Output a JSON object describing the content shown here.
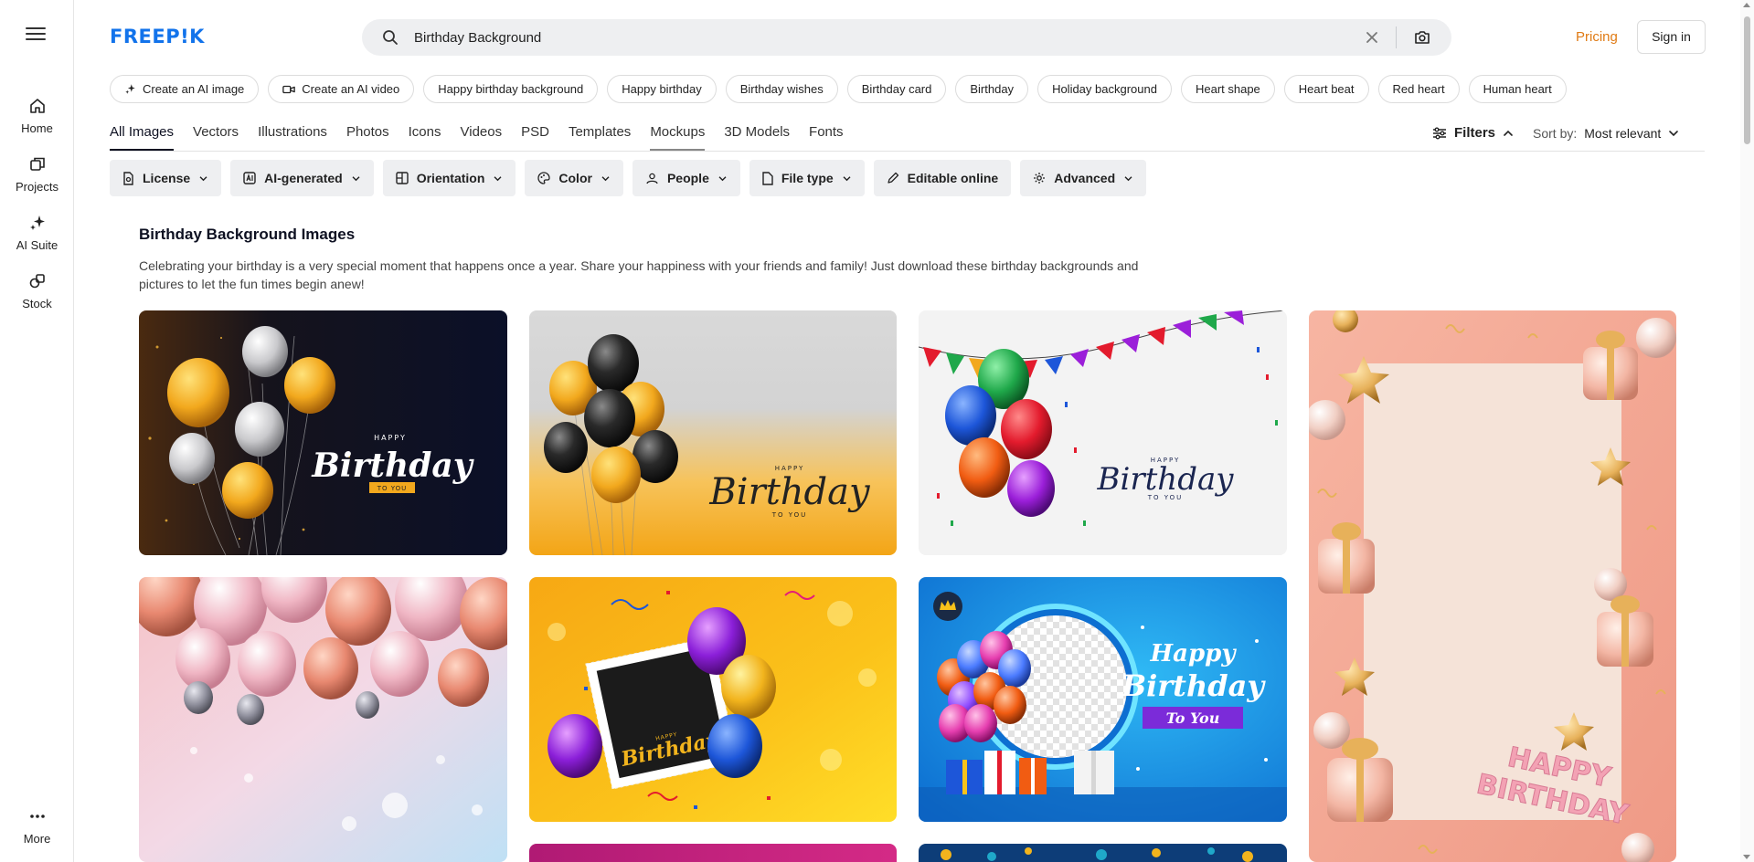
{
  "rail": {
    "items": [
      {
        "label": "Home",
        "icon": "home-icon"
      },
      {
        "label": "Projects",
        "icon": "projects-icon"
      },
      {
        "label": "AI Suite",
        "icon": "sparkle-icon"
      },
      {
        "label": "Stock",
        "icon": "stock-icon"
      }
    ],
    "more_label": "More"
  },
  "header": {
    "logo": "FREEP!K",
    "search_value": "Birthday Background",
    "pricing": "Pricing",
    "signin": "Sign in"
  },
  "chips": [
    {
      "label": "Create an AI image",
      "icon": "sparkle-icon"
    },
    {
      "label": "Create an AI video",
      "icon": "video-icon"
    },
    {
      "label": "Happy birthday background"
    },
    {
      "label": "Happy birthday"
    },
    {
      "label": "Birthday wishes"
    },
    {
      "label": "Birthday card"
    },
    {
      "label": "Birthday"
    },
    {
      "label": "Holiday background"
    },
    {
      "label": "Heart shape"
    },
    {
      "label": "Heart beat"
    },
    {
      "label": "Red heart"
    },
    {
      "label": "Human heart"
    }
  ],
  "tabs": {
    "items": [
      "All Images",
      "Vectors",
      "Illustrations",
      "Photos",
      "Icons",
      "Videos",
      "PSD",
      "Templates",
      "Mockups",
      "3D Models",
      "Fonts"
    ],
    "active": "All Images",
    "filters_label": "Filters",
    "sort_label": "Sort by:",
    "sort_value": "Most relevant"
  },
  "filter_buttons": [
    {
      "label": "License",
      "icon": "license-icon"
    },
    {
      "label": "AI-generated",
      "icon": "ai-icon"
    },
    {
      "label": "Orientation",
      "icon": "orientation-icon"
    },
    {
      "label": "Color",
      "icon": "palette-icon"
    },
    {
      "label": "People",
      "icon": "people-icon"
    },
    {
      "label": "File type",
      "icon": "file-icon"
    },
    {
      "label": "Editable online",
      "icon": "pencil-icon"
    },
    {
      "label": "Advanced",
      "icon": "gear-icon"
    }
  ],
  "content": {
    "title": "Birthday Background Images",
    "description": "Celebrating your birthday is a very special moment that happens once a year. Share your happiness with your friends and family! Just download these birthday backgrounds and pictures to let the fun times begin anew!"
  },
  "cards": {
    "card1": {
      "small": "HAPPY",
      "main": "Birthday",
      "ribbon": "TO YOU"
    },
    "card2": {
      "small": "HAPPY",
      "main": "Birthday",
      "sub": "TO YOU"
    },
    "card3": {
      "small": "HAPPY",
      "main": "Birthday",
      "sub": "TO YOU"
    },
    "card4": {
      "word1": "HAPPY",
      "word2": "BIRTHDAY"
    },
    "card6": {
      "small": "HAPPY",
      "main": "Birthday"
    },
    "card7": {
      "line1": "Happy",
      "line2": "Birthday",
      "ribbon": "To You"
    }
  }
}
